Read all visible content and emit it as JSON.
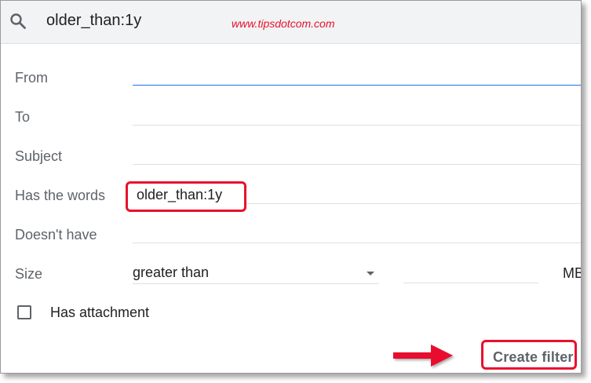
{
  "search": {
    "query": "older_than:1y",
    "icon": "search-icon"
  },
  "watermark": "www.tipsdotcom.com",
  "form": {
    "from_label": "From",
    "to_label": "To",
    "subject_label": "Subject",
    "has_words_label": "Has the words",
    "has_words_value": "older_than:1y",
    "doesnt_have_label": "Doesn't have",
    "size_label": "Size",
    "size_operator": "greater than",
    "size_unit": "MB",
    "has_attachment_label": "Has attachment"
  },
  "actions": {
    "create_filter_label": "Create filter"
  },
  "colors": {
    "highlight": "#e8112d",
    "accent": "#1a73e8",
    "searchbar_bg": "#f1f3f4",
    "label_text": "#5f6368"
  }
}
